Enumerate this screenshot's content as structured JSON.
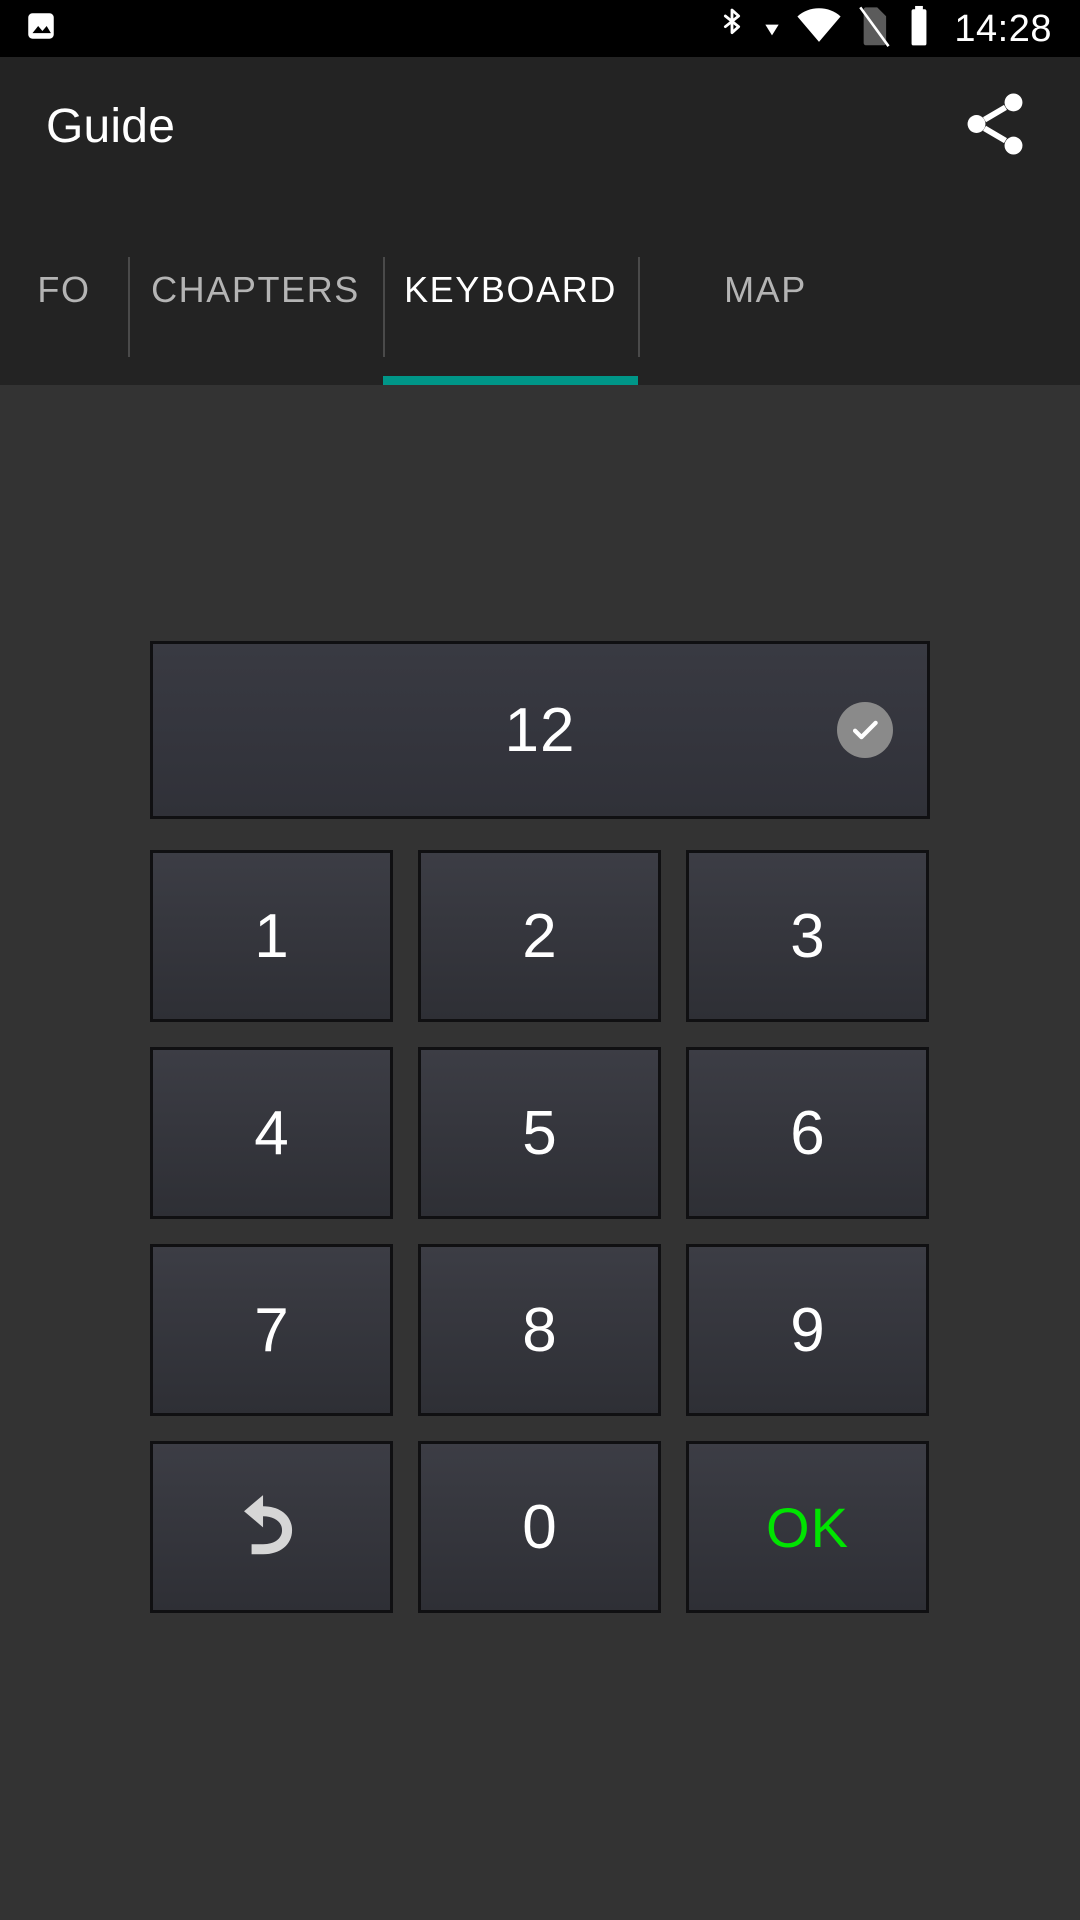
{
  "status_bar": {
    "left_icons": [
      {
        "name": "photo-icon",
        "label": "image"
      }
    ],
    "right_icons": [
      {
        "name": "bluetooth-icon",
        "label": "bluetooth"
      },
      {
        "name": "download-arrow-icon",
        "label": "download"
      },
      {
        "name": "wifi-icon",
        "label": "wifi"
      },
      {
        "name": "no-sim-icon",
        "label": "no sim card"
      },
      {
        "name": "battery-icon",
        "label": "battery"
      }
    ],
    "clock": "14:28"
  },
  "app_bar": {
    "title": "Guide",
    "share_label": "Share"
  },
  "tabs": {
    "items": [
      {
        "label": "FO",
        "active": false
      },
      {
        "label": "CHAPTERS",
        "active": false
      },
      {
        "label": "KEYBOARD",
        "active": true
      },
      {
        "label": "MAP",
        "active": false
      }
    ],
    "active_index": 2,
    "indicator_color": "#009688"
  },
  "keyboard": {
    "display_value": "12",
    "confirm_label": "Confirm",
    "keys": [
      [
        {
          "label": "1",
          "type": "digit"
        },
        {
          "label": "2",
          "type": "digit"
        },
        {
          "label": "3",
          "type": "digit"
        }
      ],
      [
        {
          "label": "4",
          "type": "digit"
        },
        {
          "label": "5",
          "type": "digit"
        },
        {
          "label": "6",
          "type": "digit"
        }
      ],
      [
        {
          "label": "7",
          "type": "digit"
        },
        {
          "label": "8",
          "type": "digit"
        },
        {
          "label": "9",
          "type": "digit"
        }
      ],
      [
        {
          "label": "",
          "type": "backspace"
        },
        {
          "label": "0",
          "type": "digit"
        },
        {
          "label": "OK",
          "type": "ok"
        }
      ]
    ],
    "ok_color": "#00e400"
  }
}
